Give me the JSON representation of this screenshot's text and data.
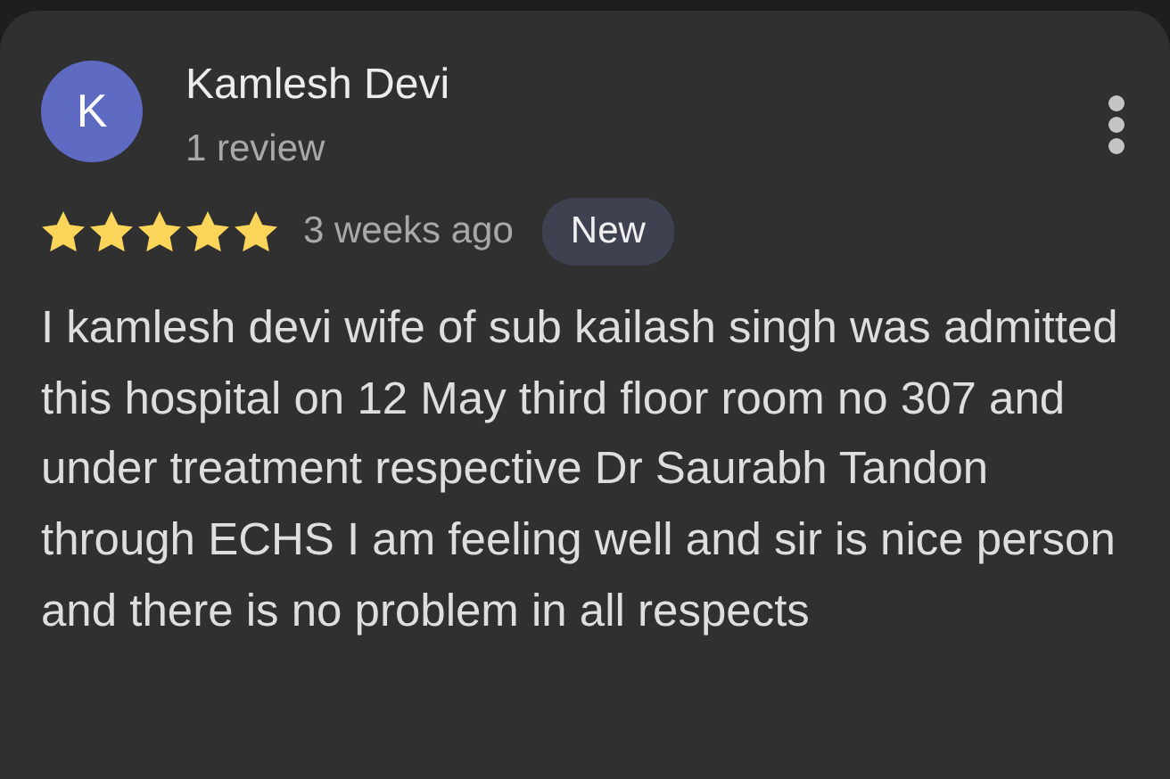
{
  "review": {
    "avatar_letter": "K",
    "reviewer": "Kamlesh Devi",
    "review_count": "1 review",
    "stars": 5,
    "time": "3 weeks ago",
    "badge": "New",
    "text": "I kamlesh devi wife of sub kailash singh was admitted this hospital on 12 May third floor room no 307 and under treatment respective Dr Saurabh Tandon through ECHS I am feeling well and sir is nice person and there is no problem in all respects"
  }
}
